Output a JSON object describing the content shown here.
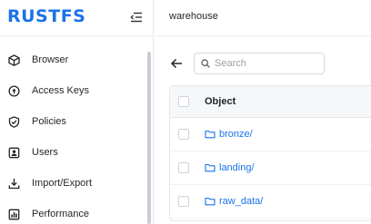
{
  "sidebar": {
    "logo": "RUSTFS",
    "items": [
      {
        "label": "Browser",
        "icon": "cube-icon"
      },
      {
        "label": "Access Keys",
        "icon": "key-circle-icon"
      },
      {
        "label": "Policies",
        "icon": "shield-check-icon"
      },
      {
        "label": "Users",
        "icon": "user-icon"
      },
      {
        "label": "Import/Export",
        "icon": "download-icon"
      },
      {
        "label": "Performance",
        "icon": "chart-icon"
      }
    ]
  },
  "header": {
    "title": "warehouse"
  },
  "toolbar": {
    "search_placeholder": "Search"
  },
  "table": {
    "column_header": "Object",
    "rows": [
      {
        "name": "bronze/"
      },
      {
        "name": "landing/"
      },
      {
        "name": "raw_data/"
      }
    ]
  },
  "colors": {
    "accent": "#1a73e8",
    "border": "#e6e8eb"
  }
}
